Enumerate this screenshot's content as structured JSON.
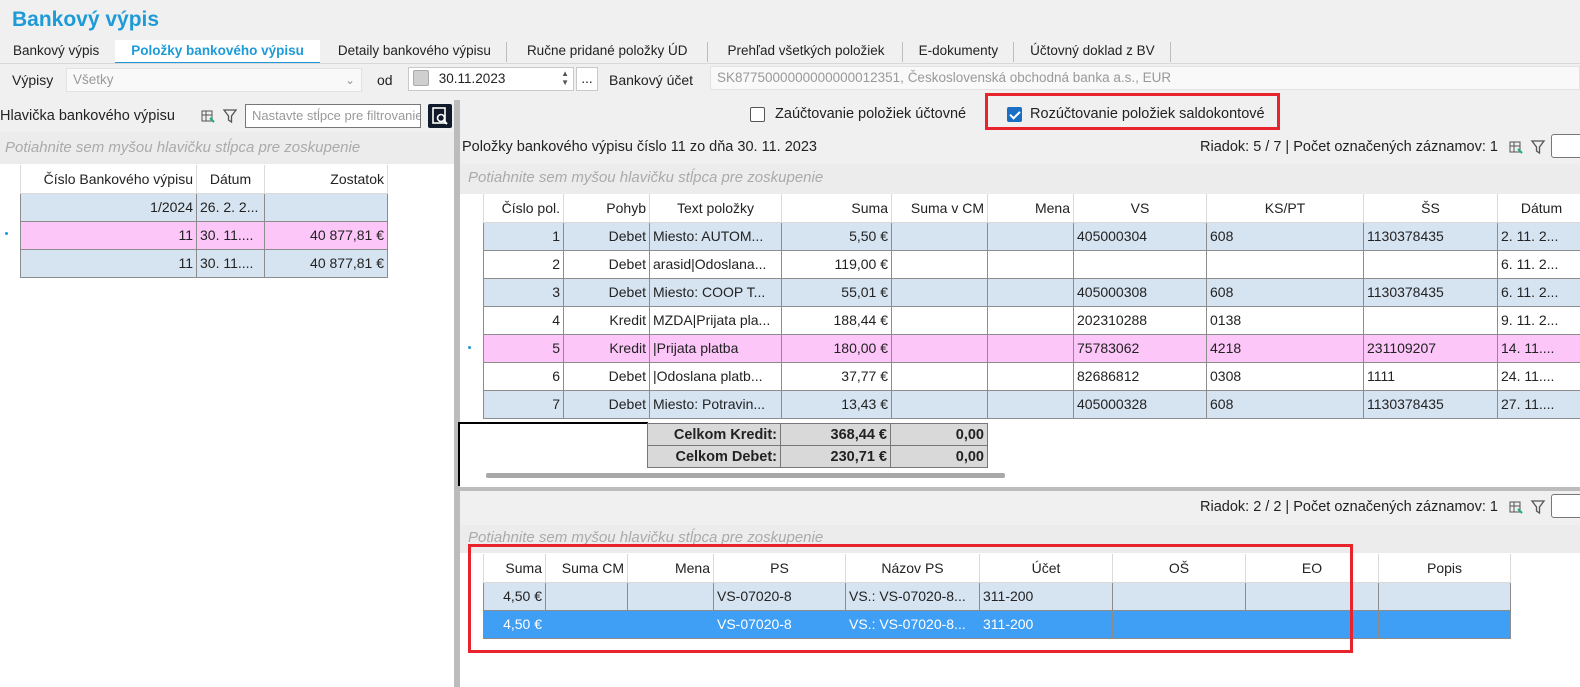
{
  "window": {
    "title": "Bankový výpis"
  },
  "tabs": [
    {
      "label": "Bankový výpis"
    },
    {
      "label": "Položky bankového výpisu"
    },
    {
      "label": "Detaily bankového výpisu"
    },
    {
      "label": "Ručne pridané položky ÚD"
    },
    {
      "label": "Prehľad všetkých položiek"
    },
    {
      "label": "E-dokumenty"
    },
    {
      "label": "Účtovný doklad z BV"
    }
  ],
  "filter": {
    "vypisy_label": "Výpisy",
    "vypisy_value": "Všetky",
    "od_label": "od",
    "date_value": "30.11.2023",
    "ellipsis": "...",
    "ucet_label": "Bankový účet",
    "ucet_value": "SK8775000000000000012351, Československá obchodná banka a.s., EUR"
  },
  "left": {
    "header_title": "Hlavička bankového výpisu",
    "filter_placeholder": "Nastavte stĺpce pre filtrovanie",
    "group_hint": "Potiahnite sem myšou hlavičku stĺpca pre zoskupenie",
    "columns": [
      "Číslo Bankového výpisu",
      "Dátum",
      "Zostatok"
    ],
    "rows": [
      [
        "1/2024",
        "26. 2. 2...",
        ""
      ],
      [
        "11",
        "30. 11....",
        "40 877,81 €"
      ],
      [
        "11",
        "30. 11....",
        "40 877,81 €"
      ]
    ]
  },
  "options": {
    "zauctovanie": "Zaúčtovanie položiek účtovné",
    "zauctovanie_checked": false,
    "rozuctovanie": "Rozúčtovanie položiek saldokontové",
    "rozuctovanie_checked": true
  },
  "items": {
    "caption": "Položky bankového výpisu číslo 11 zo dňa 30. 11. 2023",
    "status": "Riadok: 5 / 7 | Počet označených záznamov: 1",
    "group_hint": "Potiahnite sem myšou hlavičku stĺpca pre zoskupenie",
    "columns": [
      "Číslo pol.",
      "Pohyb",
      "Text položky",
      "Suma",
      "Suma v CM",
      "Mena",
      "VS",
      "KS/PT",
      "ŠS",
      "Dátum"
    ],
    "rows": [
      [
        "1",
        "Debet",
        "Miesto: AUTOM...",
        "5,50 €",
        "",
        "",
        "405000304",
        "608",
        "1130378435",
        "2. 11. 2..."
      ],
      [
        "2",
        "Debet",
        "arasid|Odoslana...",
        "119,00 €",
        "",
        "",
        "",
        "",
        "",
        "6. 11. 2..."
      ],
      [
        "3",
        "Debet",
        "Miesto: COOP T...",
        "55,01 €",
        "",
        "",
        "405000308",
        "608",
        "1130378435",
        "6. 11. 2..."
      ],
      [
        "4",
        "Kredit",
        "MZDA|Prijata pla...",
        "188,44 €",
        "",
        "",
        "202310288",
        "0138",
        "",
        "9. 11. 2..."
      ],
      [
        "5",
        "Kredit",
        "|Prijata platba",
        "180,00 €",
        "",
        "",
        "75783062",
        "4218",
        "231109207",
        "14. 11...."
      ],
      [
        "6",
        "Debet",
        "|Odoslana platb...",
        "37,77 €",
        "",
        "",
        "82686812",
        "0308",
        "1111",
        "24. 11...."
      ],
      [
        "7",
        "Debet",
        "Miesto: Potravin...",
        "13,43 €",
        "",
        "",
        "405000328",
        "608",
        "1130378435",
        "27. 11...."
      ]
    ],
    "totals": [
      {
        "label": "Celkom Kredit:",
        "suma": "368,44 €",
        "cm": "0,00"
      },
      {
        "label": "Celkom Debet:",
        "suma": "230,71 €",
        "cm": "0,00"
      }
    ]
  },
  "detail": {
    "status": "Riadok: 2 / 2 | Počet označených záznamov: 1",
    "group_hint": "Potiahnite sem myšou hlavičku stĺpca pre zoskupenie",
    "columns": [
      "Suma",
      "Suma CM",
      "Mena",
      "PS",
      "Názov PS",
      "Účet",
      "OŠ",
      "EO",
      "Popis"
    ],
    "rows": [
      [
        "4,50 €",
        "",
        "",
        "VS-07020-8",
        "VS.: VS-07020-8...",
        "311-200",
        "",
        "",
        ""
      ],
      [
        "4,50 €",
        "",
        "",
        "VS-07020-8",
        "VS.: VS-07020-8...",
        "311-200",
        "",
        "",
        ""
      ]
    ]
  },
  "colors": {
    "accent": "#1e9bd7",
    "highlight": "#e8232b",
    "row_alt": "#d6e4f2",
    "row_current": "#fcc6f9",
    "row_selected": "#3f9ff5"
  }
}
